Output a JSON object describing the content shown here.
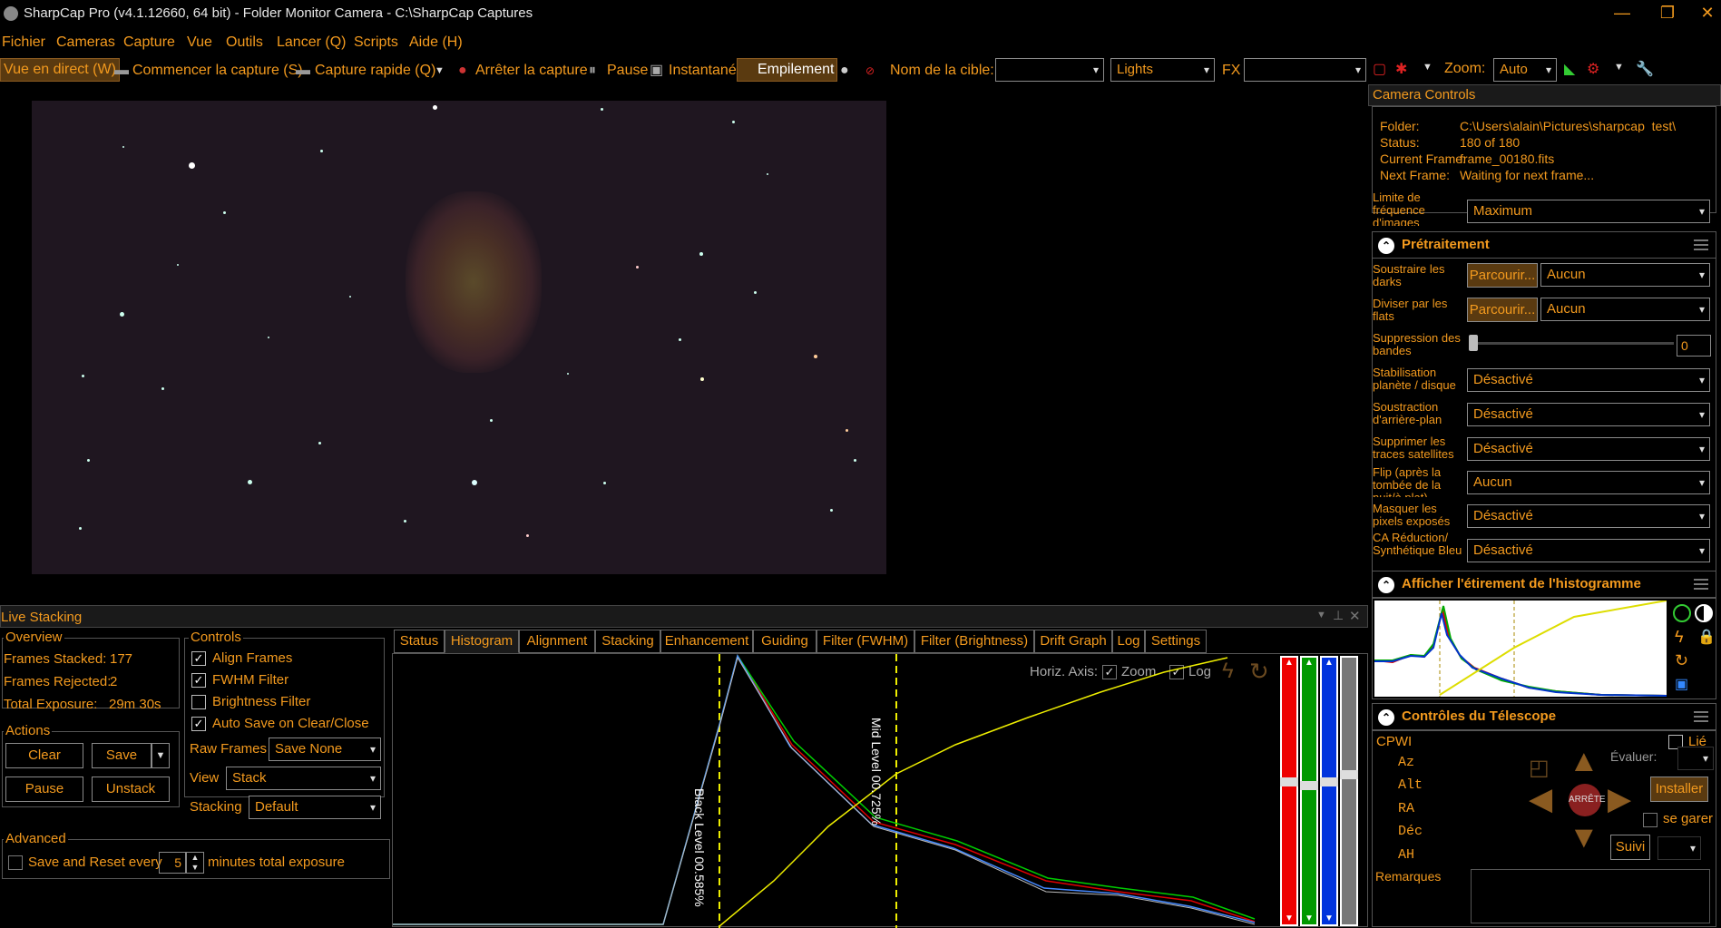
{
  "app": {
    "title": "SharpCap Pro (v4.1.12660, 64 bit) - Folder Monitor Camera - C:\\SharpCap Captures"
  },
  "menu": [
    "Fichier",
    "Cameras",
    "Capture",
    "Vue",
    "Outils",
    "Lancer (Q)",
    "Scripts",
    "Aide (H)"
  ],
  "toolbar": {
    "live_view": "Vue en direct (W)",
    "start_capture": "Commencer la capture (S)",
    "quick_capture": "Capture rapide (Q)",
    "stop_capture": "Arrêter la capture",
    "pause": "Pause",
    "snapshot": "Instantané",
    "stacking": "Empilement",
    "target_label": "Nom de la cible:",
    "target_value": "",
    "frame_type": "Lights",
    "fx_label": "FX",
    "fx_value": "",
    "zoom_label": "Zoom:",
    "zoom_value": "Auto"
  },
  "camera_controls": {
    "title": "Camera Controls",
    "folder_label": "Folder:",
    "folder_value": "C:\\Users\\alain\\Pictures\\sharpcap_test\\",
    "status_label": "Status:",
    "status_value": "180 of 180",
    "current_label": "Current Frame:",
    "current_value": "frame_00180.fits",
    "next_label": "Next Frame:",
    "next_value": "Waiting for next frame...",
    "rate_label": "Limite de fréquence d'images",
    "rate_value": "Maximum"
  },
  "preprocessing": {
    "title": "Prétraitement",
    "rows": [
      {
        "label": "Soustraire les darks",
        "browse": "Parcourir...",
        "value": "Aucun"
      },
      {
        "label": "Diviser par les flats",
        "browse": "Parcourir...",
        "value": "Aucun"
      }
    ],
    "banding_label": "Suppression des bandes",
    "banding_value": "0",
    "options": [
      {
        "label": "Stabilisation planète / disque",
        "value": "Désactivé"
      },
      {
        "label": "Soustraction d'arrière-plan",
        "value": "Désactivé"
      },
      {
        "label": "Supprimer les traces satellites",
        "value": "Désactivé"
      },
      {
        "label": "Flip (après la tombée de la nuit/à plat)",
        "value": "Aucun"
      },
      {
        "label": "Masquer les pixels exposés",
        "value": "Désactivé"
      },
      {
        "label": "CA Réduction/ Synthétique Bleu",
        "value": "Désactivé"
      }
    ]
  },
  "histogram_stretch": {
    "title": "Afficher l'étirement de l'histogramme"
  },
  "telescope": {
    "title": "Contrôles du Télescope",
    "mount": "CPWI",
    "linked": "Lié",
    "axes": [
      "Az",
      "Alt",
      "RA",
      "Déc",
      "AH"
    ],
    "rate_label": "Évaluer:",
    "install": "Installer",
    "stop": "ARRÊTE",
    "park": "se garer",
    "tracking": "Suivi",
    "remarks": "Remarques"
  },
  "live_stacking": {
    "title": "Live Stacking",
    "overview": {
      "title": "Overview",
      "frames_stacked_label": "Frames Stacked:",
      "frames_stacked": "177",
      "frames_rejected_label": "Frames Rejected:",
      "frames_rejected": "2",
      "total_exposure_label": "Total Exposure:",
      "total_exposure": "29m 30s"
    },
    "actions": {
      "title": "Actions",
      "clear": "Clear",
      "save": "Save",
      "pause": "Pause",
      "unstack": "Unstack"
    },
    "controls": {
      "title": "Controls",
      "align": "Align Frames",
      "fwhm": "FWHM Filter",
      "brightness": "Brightness Filter",
      "autosave": "Auto Save on Clear/Close",
      "raw_label": "Raw Frames",
      "raw_value": "Save None",
      "view_label": "View",
      "view_value": "Stack",
      "stacking_label": "Stacking",
      "stacking_value": "Default"
    },
    "advanced": {
      "title": "Advanced",
      "save_reset": "Save and Reset every",
      "minutes_value": "5",
      "minutes_suffix": "minutes total exposure"
    },
    "tabs": [
      "Status",
      "Histogram",
      "Alignment",
      "Stacking",
      "Enhancement",
      "Guiding",
      "Filter (FWHM)",
      "Filter (Brightness)",
      "Drift Graph",
      "Log",
      "Settings"
    ],
    "active_tab": "Histogram",
    "histogram": {
      "horiz_axis": "Horiz. Axis:",
      "zoom": "Zoom",
      "log": "Log",
      "black_level": "Black Level  00.585%",
      "mid_level": "Mid Level  00.725%"
    }
  },
  "colors": {
    "accent": "#f39a1e",
    "background": "#000000"
  }
}
